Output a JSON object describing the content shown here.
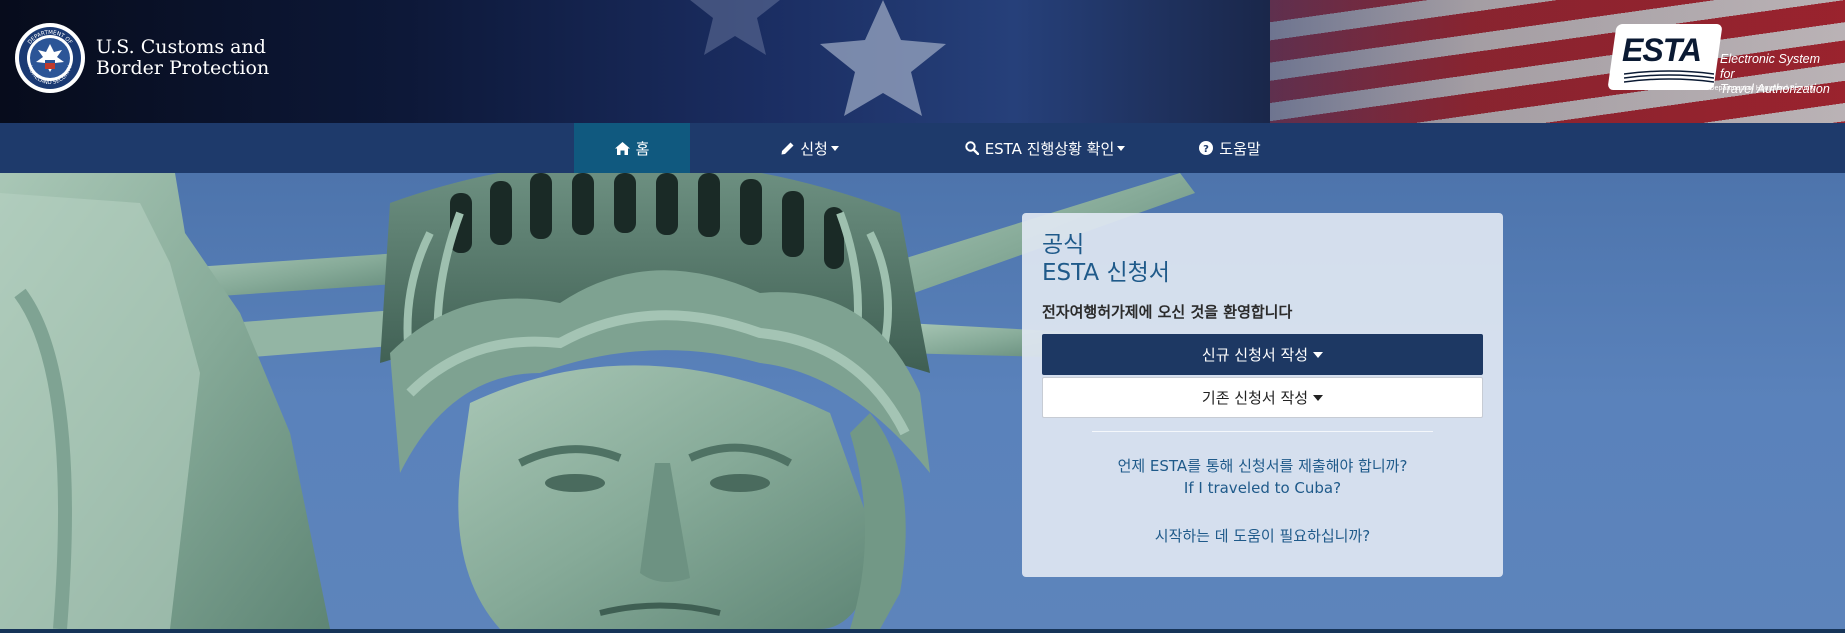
{
  "header": {
    "agency_name_line1": "U.S. Customs and",
    "agency_name_line2": "Border Protection",
    "esta_logo_word": "ESTA",
    "esta_subtitle_line1": "Electronic System for",
    "esta_subtitle_line2": "Travel Authorization",
    "esta_dhs_text": "U.S. Department of Homeland Security",
    "seal_text_top": "DEPARTMENT OF",
    "seal_text_bottom": "HOMELAND SECURITY"
  },
  "nav": {
    "items": [
      {
        "label": "홈",
        "icon": "home-icon",
        "active": true,
        "dropdown": false
      },
      {
        "label": "신청",
        "icon": "pencil-icon",
        "active": false,
        "dropdown": true
      },
      {
        "label": "ESTA 진행상황 확인",
        "icon": "search-icon",
        "active": false,
        "dropdown": true
      },
      {
        "label": "도움말",
        "icon": "question-circle-icon",
        "active": false,
        "dropdown": false
      }
    ]
  },
  "card": {
    "title_line1": "공식",
    "title_line2": "ESTA 신청서",
    "welcome": "전자여행허가제에 오신 것을 환영합니다",
    "new_application_label": "신규 신청서 작성",
    "existing_application_label": "기존 신청서 작성",
    "links": [
      "언제 ESTA를 통해 신청서를 제출해야 합니까?",
      "If I traveled to Cuba?",
      "시작하는 데 도움이 필요하십니까?"
    ]
  },
  "colors": {
    "nav_bg": "#1e3a6b",
    "nav_active": "#10597f",
    "primary_button": "#1d3863",
    "link": "#1f5a8a"
  }
}
